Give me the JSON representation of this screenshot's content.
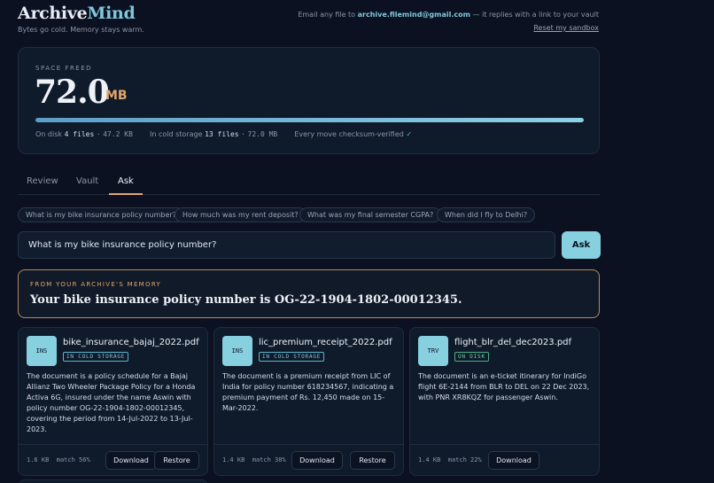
{
  "header": {
    "brand_prefix": "Archive",
    "brand_accent": "Mind",
    "tagline": "Bytes go cold. Memory stays warm.",
    "email_prefix": "Email any file to",
    "email": "archive.filemind@gmail.com",
    "email_suffix": "— it replies with a link to your vault",
    "reset_label": "Reset my sandbox"
  },
  "stats": {
    "label": "SPACE FREED",
    "value": "72.0",
    "unit": "MB",
    "progress_fraction": 1.0,
    "on_disk_label": "On disk",
    "on_disk_files": "4 files",
    "on_disk_size": "47.2 KB",
    "cold_label": "In cold storage",
    "cold_files": "13 files",
    "cold_size": "72.0 MB",
    "verify_text": "Every move checksum-verified",
    "verify_mark": "✓"
  },
  "tabs": [
    {
      "label": "Review"
    },
    {
      "label": "Vault"
    },
    {
      "label": "Ask",
      "active": true
    }
  ],
  "chips": [
    "What is my bike insurance policy number?",
    "How much was my rent deposit?",
    "What was my final semester CGPA?",
    "When did I fly to Delhi?"
  ],
  "query": {
    "value": "What is my bike insurance policy number?",
    "button": "Ask"
  },
  "answer": {
    "label": "FROM YOUR ARCHIVE'S MEMORY",
    "text": "Your bike insurance policy number is OG-22-1904-1802-00012345."
  },
  "results": [
    {
      "tag": "INS",
      "filename": "bike_insurance_bajaj_2022.pdf",
      "status": "IN COLD STORAGE",
      "description": "The document is a policy schedule for a Bajaj Allianz Two Wheeler Package Policy for a Honda Activa 6G, insured under the name Aswin with policy number OG-22-1904-1802-00012345, covering the period from 14-Jul-2022 to 13-Jul-2023.",
      "size": "1.6 KB",
      "match": "match 56%",
      "download": "Download",
      "restore": "Restore"
    },
    {
      "tag": "INS",
      "filename": "lic_premium_receipt_2022.pdf",
      "status": "IN COLD STORAGE",
      "description": "The document is a premium receipt from LIC of India for policy number 618234567, indicating a premium payment of Rs. 12,450 made on 15-Mar-2022.",
      "size": "1.4 KB",
      "match": "match 38%",
      "download": "Download",
      "restore": "Restore"
    },
    {
      "tag": "TRV",
      "filename": "flight_blr_del_dec2023.pdf",
      "status": "ON DISK",
      "description": "The document is an e-ticket itinerary for IndiGo flight 6E-2144 from BLR to DEL on 22 Dec 2023, with PNR XR8KQZ for passenger Aswin.",
      "size": "1.4 KB",
      "match": "match 22%",
      "download": "Download"
    }
  ]
}
